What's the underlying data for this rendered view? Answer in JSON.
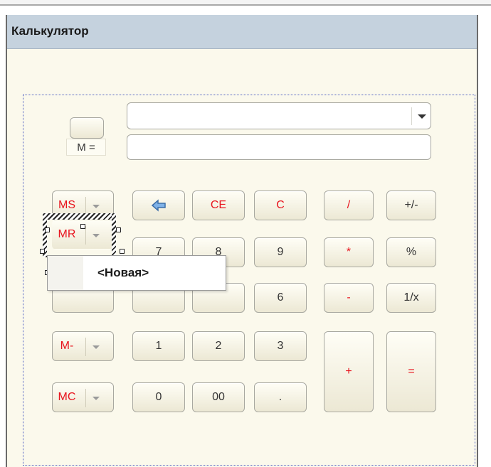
{
  "window": {
    "title": "Калькулятор"
  },
  "memory_indicator": {
    "label": "M ="
  },
  "display": {
    "combo_value": "",
    "input_value": ""
  },
  "memory_buttons": [
    {
      "label": "MS"
    },
    {
      "label": "MR"
    },
    {
      "label": ""
    },
    {
      "label": "M-"
    },
    {
      "label": "MC"
    }
  ],
  "keys": {
    "backspace": "backspace-icon",
    "ce": "CE",
    "c": "C",
    "divide": "/",
    "sign": "+/-",
    "seven": "7",
    "eight": "8",
    "nine": "9",
    "multiply": "*",
    "percent": "%",
    "six": "6",
    "minus": "-",
    "reciprocal": "1/x",
    "one": "1",
    "two": "2",
    "three": "3",
    "plus": "+",
    "equals": "=",
    "zero": "0",
    "double_zero": "00",
    "dot": "."
  },
  "context_menu": {
    "items": [
      "<Новая>"
    ]
  },
  "colors": {
    "accent_red": "#e8141e",
    "title_bg": "#c5d2de",
    "form_bg": "#fbf9ec",
    "selection_border": "#5666c4"
  }
}
